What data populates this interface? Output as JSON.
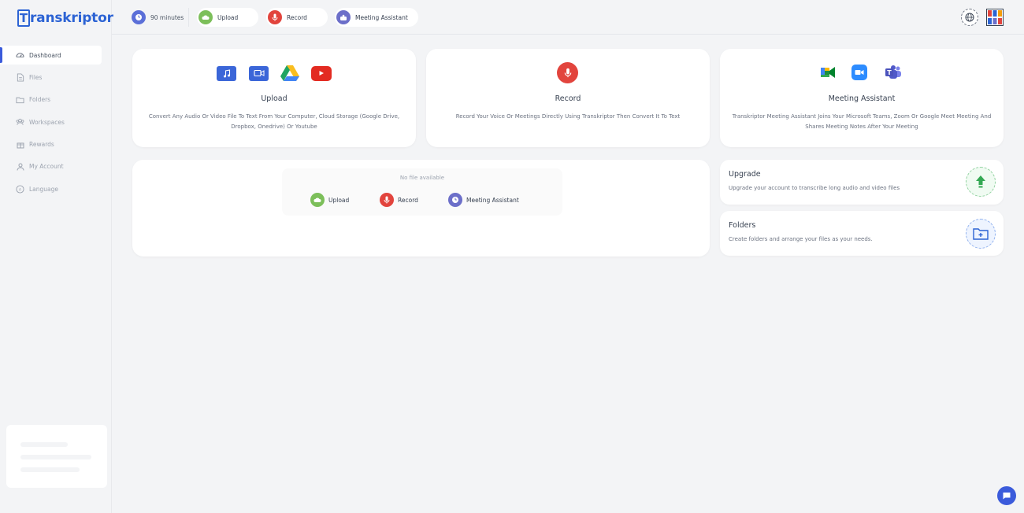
{
  "app": {
    "logo_initial": "T",
    "logo_rest": "ranskriptor"
  },
  "sidebar": {
    "items": [
      {
        "label": "Dashboard",
        "icon": "dashboard-icon",
        "active": true
      },
      {
        "label": "Files",
        "icon": "file-icon",
        "active": false
      },
      {
        "label": "Folders",
        "icon": "folder-icon",
        "active": false
      },
      {
        "label": "Workspaces",
        "icon": "workspaces-icon",
        "active": false
      },
      {
        "label": "Rewards",
        "icon": "gift-icon",
        "active": false
      },
      {
        "label": "My Account",
        "icon": "user-icon",
        "active": false
      },
      {
        "label": "Language",
        "icon": "language-icon",
        "active": false
      }
    ]
  },
  "topbar": {
    "minutes": "90 minutes",
    "upload": "Upload",
    "record": "Record",
    "meeting": "Meeting Assistant"
  },
  "cards": {
    "upload": {
      "title": "Upload",
      "desc": "Convert Any Audio Or Video File To Text From Your Computer, Cloud Storage (Google Drive, Dropbox, Onedrive) Or Youtube"
    },
    "record": {
      "title": "Record",
      "desc": "Record Your Voice Or Meetings Directly Using Transkriptor Then Convert It To Text"
    },
    "meeting": {
      "title": "Meeting Assistant",
      "desc": "Transkriptor Meeting Assistant Joins Your Microsoft Teams, Zoom Or Google Meet Meeting And Shares Meeting Notes After Your Meeting"
    }
  },
  "files": {
    "empty": "No file available",
    "upload": "Upload",
    "record": "Record",
    "meeting": "Meeting Assistant"
  },
  "upgrade": {
    "title": "Upgrade",
    "desc": "Upgrade your account to transcribe long audio and video files"
  },
  "folders": {
    "title": "Folders",
    "desc": "Create folders and arrange your files as your needs."
  },
  "colors": {
    "brand": "#2c63d4",
    "upload_green": "#7cbf5a",
    "record_red": "#e2443d",
    "meeting_purple": "#6c6fc9"
  }
}
